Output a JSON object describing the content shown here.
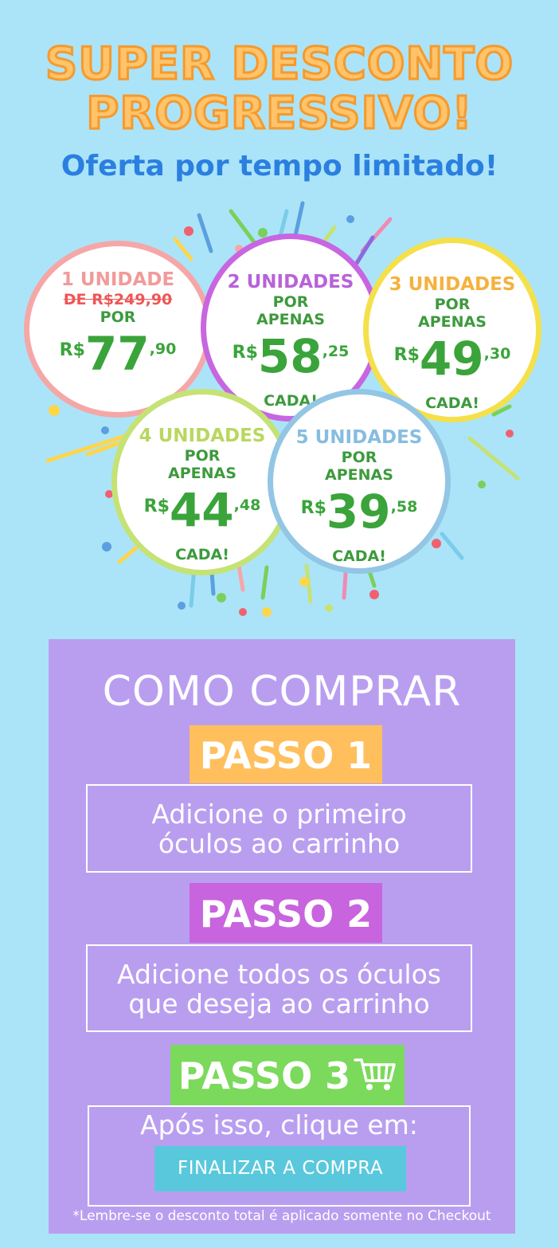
{
  "hero": {
    "title_line1": "SUPER DESCONTO",
    "title_line2": "PROGRESSIVO!",
    "subtitle": "Oferta por tempo limitado!"
  },
  "offers": [
    {
      "units": "1 UNIDADE",
      "old_price": "DE R$249,90",
      "por": "POR",
      "currency": "R$",
      "price_int": "77",
      "price_cents": ",90"
    },
    {
      "units": "2 UNIDADES",
      "por": "POR",
      "apenas": "APENAS",
      "currency": "R$",
      "price_int": "58",
      "price_cents": ",25",
      "cada": "CADA!"
    },
    {
      "units": "3 UNIDADES",
      "por": "POR",
      "apenas": "APENAS",
      "currency": "R$",
      "price_int": "49",
      "price_cents": ",30",
      "cada": "CADA!"
    },
    {
      "units": "4 UNIDADES",
      "por": "POR",
      "apenas": "APENAS",
      "currency": "R$",
      "price_int": "44",
      "price_cents": ",48",
      "cada": "CADA!"
    },
    {
      "units": "5 UNIDADES",
      "por": "POR",
      "apenas": "APENAS",
      "currency": "R$",
      "price_int": "39",
      "price_cents": ",58",
      "cada": "CADA!"
    }
  ],
  "how_to_buy": {
    "title": "COMO COMPRAR",
    "steps": [
      {
        "label": "PASSO 1",
        "text_line1": "Adicione o primeiro",
        "text_line2": "óculos ao carrinho"
      },
      {
        "label": "PASSO 2",
        "text_line1": "Adicione todos os óculos",
        "text_line2": "que deseja ao carrinho"
      },
      {
        "label": "PASSO 3",
        "icon": "cart-icon",
        "text_line1": "Após isso, clique em:"
      }
    ],
    "checkout_button": "FINALIZAR A COMPRA",
    "note": "*Lembre-se o desconto total é aplicado somente no Checkout"
  },
  "colors": {
    "background": "#abe4f8",
    "panel": "#b99ef0",
    "step1": "#ffbf5c",
    "step2": "#c864de",
    "step3": "#7bd95b",
    "checkout": "#5ac8dc",
    "price_green": "#3aa43a",
    "headline_orange": "#ffc36a",
    "subtitle_blue": "#2a7fe0"
  }
}
